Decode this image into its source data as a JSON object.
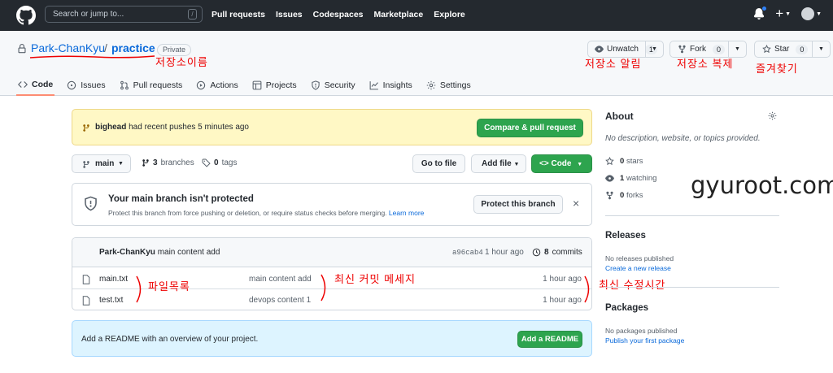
{
  "topbar": {
    "search_placeholder": "Search or jump to...",
    "slash_hint": "/",
    "nav": [
      "Pull requests",
      "Issues",
      "Codespaces",
      "Marketplace",
      "Explore"
    ],
    "plus": "+"
  },
  "repo": {
    "owner": "Park-ChanKyu",
    "separator": "/",
    "name": "practice",
    "visibility": "Private"
  },
  "actions": {
    "unwatch_label": "Unwatch",
    "unwatch_count": "1",
    "fork_label": "Fork",
    "fork_count": "0",
    "star_label": "Star",
    "star_count": "0"
  },
  "annotations": {
    "repo_name": "저장소이름",
    "watch": "저장소 알림",
    "fork": "저장소 복제",
    "star": "즐겨찾기",
    "files": "파일목록",
    "commit_msg": "최신 커밋 메세지",
    "modified": "최신 수정시간",
    "watermark": "gyuroot.com"
  },
  "tabs": [
    "Code",
    "Issues",
    "Pull requests",
    "Actions",
    "Projects",
    "Security",
    "Insights",
    "Settings"
  ],
  "push_banner": {
    "user": "bighead",
    "text": " had recent pushes 5 minutes ago",
    "button": "Compare & pull request"
  },
  "branchbar": {
    "branch": "main",
    "branches_count": "3",
    "branches_label": "branches",
    "tags_count": "0",
    "tags_label": "tags",
    "goto_file": "Go to file",
    "add_file": "Add file",
    "code": "Code"
  },
  "protect": {
    "title": "Your main branch isn't protected",
    "subtitle": "Protect this branch from force pushing or deletion, or require status checks before merging.",
    "learn_more": "Learn more",
    "button": "Protect this branch",
    "close": "×"
  },
  "commit": {
    "author": "Park-ChanKyu",
    "message": "main content add",
    "hash": "a96cab4",
    "time": "1 hour ago",
    "count": "8",
    "count_label": "commits"
  },
  "files": [
    {
      "name": "main.txt",
      "message": "main content add",
      "time": "1 hour ago"
    },
    {
      "name": "test.txt",
      "message": "devops content 1",
      "time": "1 hour ago"
    }
  ],
  "readme": {
    "text": "Add a README with an overview of your project.",
    "button": "Add a README"
  },
  "sidebar": {
    "about_title": "About",
    "about_desc": "No description, website, or topics provided.",
    "stars_count": "0",
    "stars_label": "stars",
    "watching_count": "1",
    "watching_label": "watching",
    "forks_count": "0",
    "forks_label": "forks",
    "releases_title": "Releases",
    "releases_text": "No releases published",
    "releases_link": "Create a new release",
    "packages_title": "Packages",
    "packages_text": "No packages published",
    "packages_link": "Publish your first package"
  },
  "colors": {
    "topbar": "#24292f",
    "accent_green": "#2da44e",
    "link_blue": "#0969da",
    "annotation_red": "#e00000",
    "tab_underline": "#fd8c73"
  },
  "icons": [
    "github-logo-icon",
    "bell-icon",
    "plus-icon",
    "avatar",
    "lock-icon",
    "eye-icon",
    "fork-icon",
    "star-icon",
    "code-icon",
    "issue-icon",
    "pull-request-icon",
    "play-icon",
    "table-icon",
    "shield-icon",
    "graph-icon",
    "gear-icon",
    "branch-icon",
    "tag-icon",
    "history-icon",
    "file-icon"
  ]
}
